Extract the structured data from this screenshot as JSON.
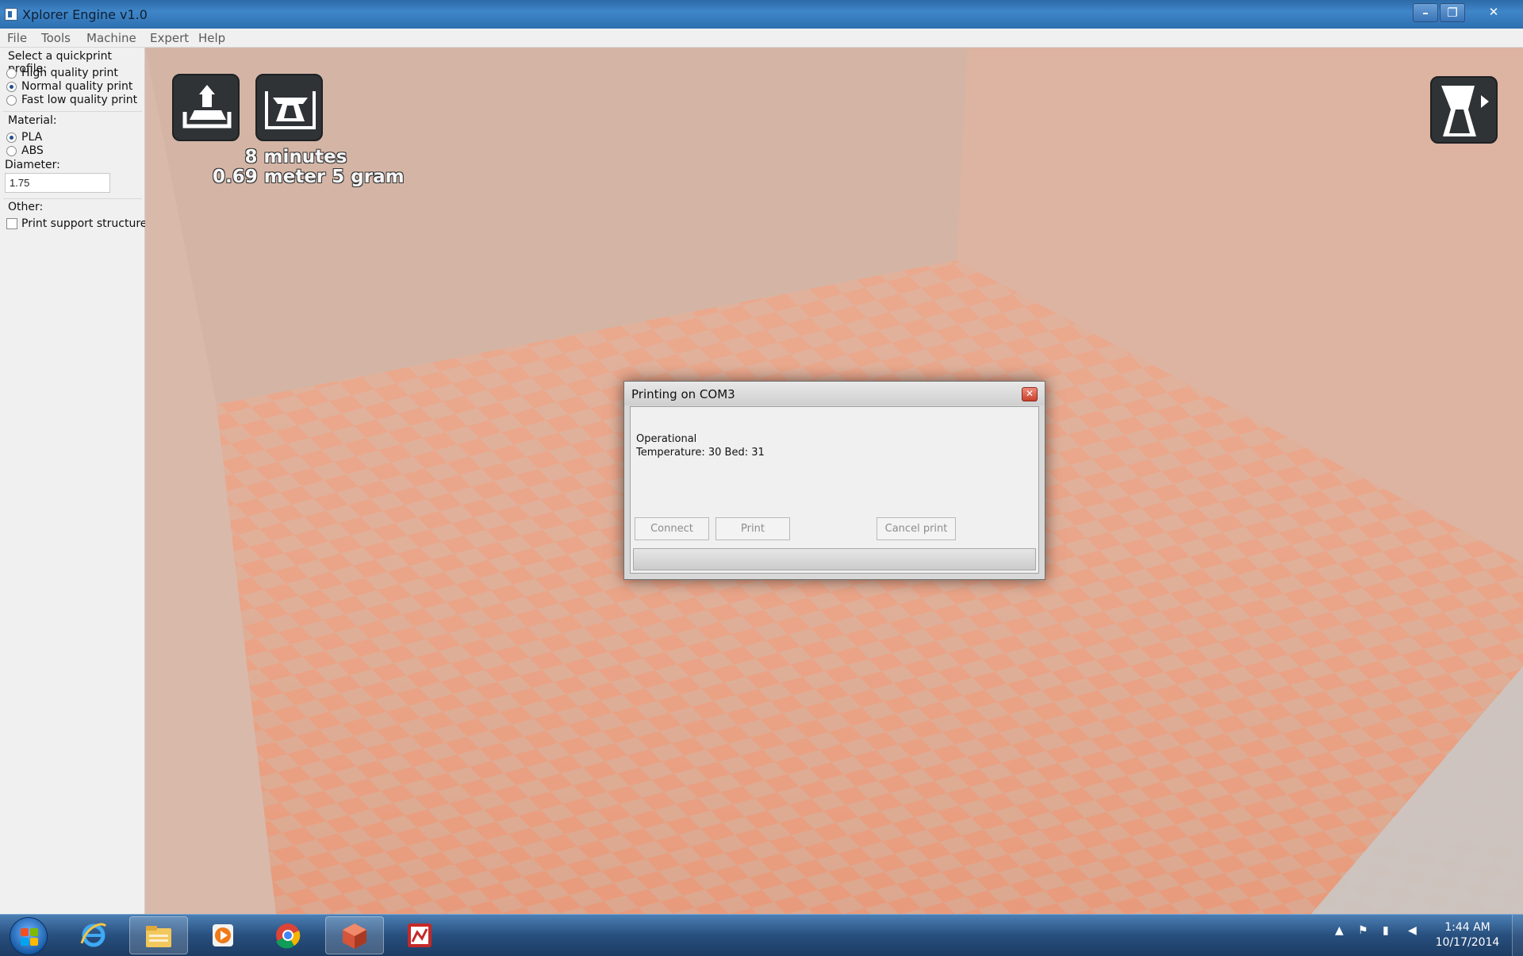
{
  "window": {
    "title": "Xplorer Engine v1.0"
  },
  "menu": [
    "File",
    "Tools",
    "Machine",
    "Expert",
    "Help"
  ],
  "profile": {
    "heading": "Select a quickprint profile:",
    "options": [
      "High quality print",
      "Normal quality print",
      "Fast low quality print"
    ],
    "selected": "Normal quality print"
  },
  "material": {
    "heading": "Material:",
    "options": [
      "PLA",
      "ABS"
    ],
    "selected": "PLA"
  },
  "diameter": {
    "label": "Diameter:",
    "value": "1.75"
  },
  "other": {
    "heading": "Other:",
    "support_label": "Print support structure",
    "support_checked": false
  },
  "viewport": {
    "estimate_time": "8 minutes",
    "estimate_material": "0.69 meter 5 gram",
    "icons": [
      "load-model-icon",
      "print-icon",
      "view-mode-icon"
    ],
    "floor_colors": [
      "#e79a7c",
      "#dca78e"
    ],
    "wall_color": "#d4b3a3"
  },
  "dialog": {
    "title": "Printing on COM3",
    "status_line": "Operational",
    "temperature_line": "Temperature: 30 Bed: 31",
    "buttons": {
      "connect": "Connect",
      "print": "Print",
      "cancel": "Cancel print"
    },
    "progress_percent": 0
  },
  "taskbar": {
    "time": "1:44 AM",
    "date": "10/17/2014",
    "apps": [
      "internet-explorer-icon",
      "file-explorer-icon",
      "media-player-icon",
      "chrome-icon",
      "xplorer-engine-icon",
      "app-icon"
    ]
  }
}
